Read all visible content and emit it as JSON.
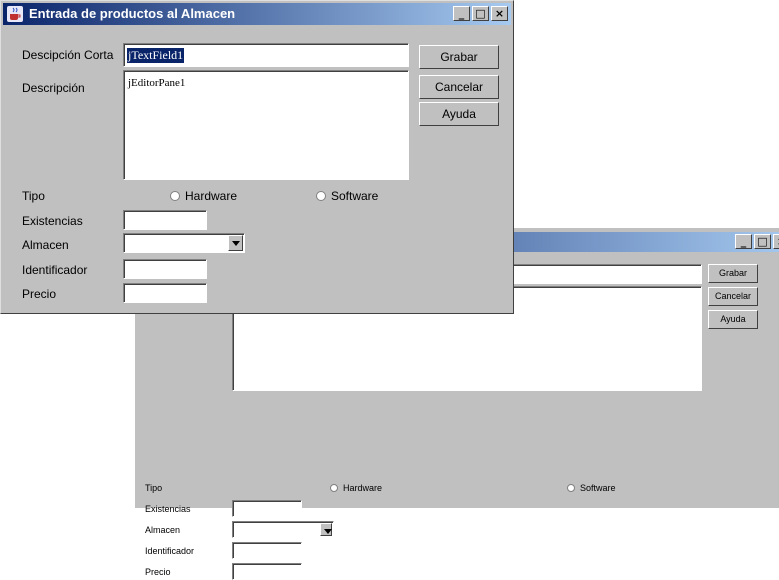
{
  "window": {
    "title": "Entrada de productos al Almacen",
    "title_gradient": [
      "#0a246a",
      "#a6caf0"
    ],
    "controls": [
      "_",
      "□",
      "×"
    ]
  },
  "form": {
    "desc_corta_label": "Descipción Corta",
    "desc_corta_value": "jTextField1",
    "descripcion_label": "Descripción",
    "descripcion_value": "jEditorPane1",
    "tipo_label": "Tipo",
    "hardware_label": "Hardware",
    "software_label": "Software",
    "existencias_label": "Existencias",
    "almacen_label": "Almacen",
    "identificador_label": "Identificador",
    "precio_label": "Precio"
  },
  "buttons": {
    "grabar": "Grabar",
    "cancelar": "Cancelar",
    "ayuda": "Ayuda"
  }
}
